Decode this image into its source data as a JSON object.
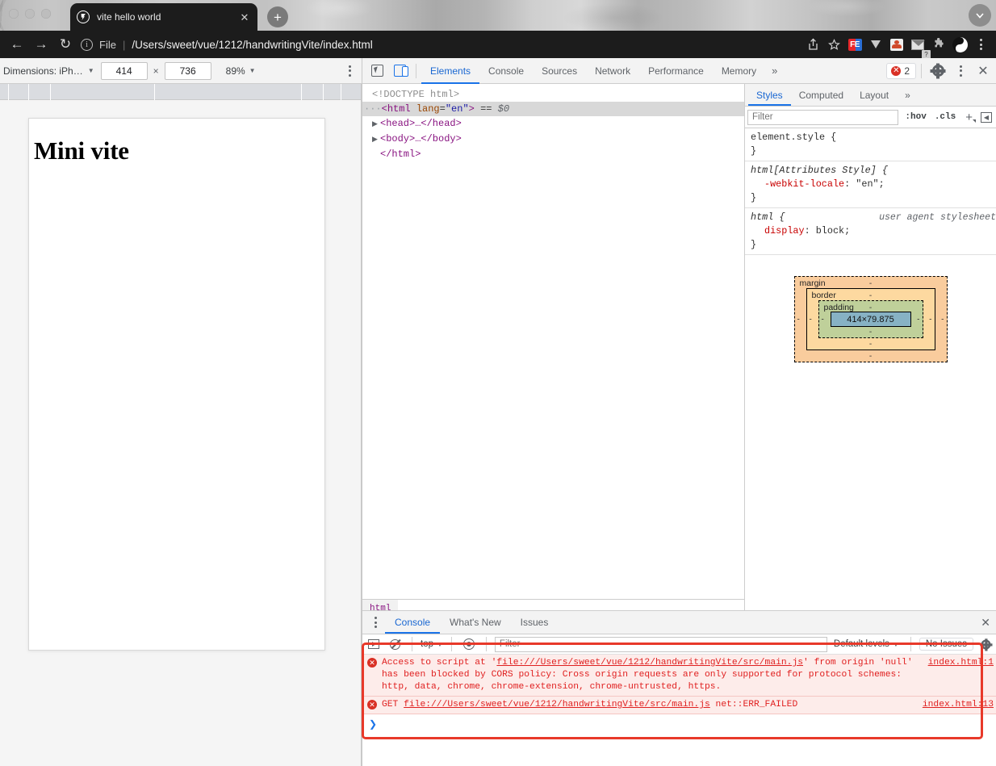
{
  "browser": {
    "tab": {
      "title": "vite hello world",
      "favicon": "globe-icon",
      "close": "✕"
    },
    "new_tab": "+",
    "tabstrip_chevron": "∨",
    "nav": {
      "back": "←",
      "forward": "→",
      "reload": "↻"
    },
    "omnibox": {
      "info_icon": "i",
      "scheme_label": "File",
      "separator": "|",
      "url": "/Users/sweet/vue/1212/handwritingVite/index.html"
    },
    "toolbar_icons": [
      {
        "name": "share-icon",
        "glyph": "⤴"
      },
      {
        "name": "bookmark-star-icon",
        "glyph": "☆"
      },
      {
        "name": "extension-fe-icon",
        "glyph": "FE"
      },
      {
        "name": "extension-v-icon",
        "glyph": "▼"
      },
      {
        "name": "extension-people-icon",
        "glyph": ""
      },
      {
        "name": "extension-mail-icon",
        "glyph": ""
      },
      {
        "name": "extension-puzzle-icon",
        "glyph": "❖"
      },
      {
        "name": "profile-avatar-icon",
        "glyph": ""
      },
      {
        "name": "chrome-menu-icon",
        "glyph": ""
      }
    ]
  },
  "device_toolbar": {
    "dimensions_label": "Dimensions: iPh…",
    "width": "414",
    "times": "×",
    "height": "736",
    "zoom": "89%",
    "caret": "▼",
    "more_label": "more-options"
  },
  "page_preview": {
    "heading": "Mini vite"
  },
  "devtools": {
    "inspect_icon": "inspect-element-icon",
    "device_icon": "toggle-device-toolbar-icon",
    "tabs": [
      {
        "label": "Elements",
        "active": true
      },
      {
        "label": "Console",
        "active": false
      },
      {
        "label": "Sources",
        "active": false
      },
      {
        "label": "Network",
        "active": false
      },
      {
        "label": "Performance",
        "active": false
      },
      {
        "label": "Memory",
        "active": false
      }
    ],
    "more_tabs": "»",
    "error_count": "2",
    "error_dot": "✕",
    "settings_icon": "gear-icon",
    "kebab_icon": "more-options-icon",
    "close_icon": "✕"
  },
  "elements": {
    "dom": [
      {
        "indent": 0,
        "prefix": "",
        "triangle": "",
        "content": "<!DOCTYPE html>",
        "selected": false,
        "kind": "doctype"
      },
      {
        "indent": 0,
        "prefix": "···",
        "triangle": "",
        "content": "<html lang=\"en\"> == $0",
        "selected": true,
        "kind": "open-html"
      },
      {
        "indent": 1,
        "prefix": "",
        "triangle": "▶",
        "content": "<head>…</head>",
        "selected": false,
        "kind": "collapsed"
      },
      {
        "indent": 1,
        "prefix": "",
        "triangle": "▶",
        "content": "<body>…</body>",
        "selected": false,
        "kind": "collapsed"
      },
      {
        "indent": 0,
        "prefix": "",
        "triangle": "",
        "content": "</html>",
        "selected": false,
        "kind": "close"
      }
    ],
    "html_tag_name": "html",
    "html_attr_name": "lang",
    "html_attr_value": "\"en\"",
    "dollar_zero": "$0",
    "equals": "==",
    "breadcrumb": [
      "html"
    ]
  },
  "styles": {
    "tabs": [
      {
        "label": "Styles",
        "active": true
      },
      {
        "label": "Computed",
        "active": false
      },
      {
        "label": "Layout",
        "active": false
      }
    ],
    "more_tabs": "»",
    "filter_placeholder": "Filter",
    "hov_label": ":hov",
    "cls_label": ".cls",
    "plus_label": "+",
    "collapse_label": "◀",
    "rules": [
      {
        "selector": "element.style {",
        "close": "}",
        "italic": false,
        "source": "",
        "declarations": []
      },
      {
        "selector": "html[Attributes Style] {",
        "close": "}",
        "italic": true,
        "source": "",
        "declarations": [
          {
            "name": "-webkit-locale",
            "value": ": \"en\";"
          }
        ]
      },
      {
        "selector": "html {",
        "close": "}",
        "italic": true,
        "source": "user agent stylesheet",
        "declarations": [
          {
            "name": "display",
            "value": ": block;"
          }
        ]
      }
    ],
    "box_model": {
      "margin_label": "margin",
      "border_label": "border",
      "padding_label": "padding",
      "content_size": "414×79.875",
      "dash": "-"
    }
  },
  "drawer": {
    "kebab": "more-options-icon",
    "tabs": [
      {
        "label": "Console",
        "active": true
      },
      {
        "label": "What's New",
        "active": false
      },
      {
        "label": "Issues",
        "active": false
      }
    ],
    "close": "✕",
    "toolbar": {
      "sidebar_icon": "console-sidebar-icon",
      "clear_icon": "clear-console-icon",
      "context": "top",
      "context_caret": "▼",
      "eye_icon": "live-expression-icon",
      "filter_placeholder": "Filter",
      "levels_label": "Default levels",
      "levels_caret": "▼",
      "issues_label": "No Issues",
      "settings_icon": "gear-icon"
    },
    "messages": [
      {
        "icon": "✕",
        "parts": [
          {
            "t": "Access to script at '",
            "link": false
          },
          {
            "t": "file:///Users/sweet/vue/1212/handwritingVite/src/main.js",
            "link": true
          },
          {
            "t": "' from origin 'null' has been blocked by CORS policy: Cross origin requests are only supported for protocol schemes: http, data, chrome, chrome-extension, chrome-untrusted, https.",
            "link": false
          }
        ],
        "source": "index.html:1"
      },
      {
        "icon": "✕",
        "parts": [
          {
            "t": "GET ",
            "link": false
          },
          {
            "t": "file:///Users/sweet/vue/1212/handwritingVite/src/main.js",
            "link": true
          },
          {
            "t": " net::ERR_FAILED",
            "link": false
          }
        ],
        "source": "index.html:13"
      }
    ],
    "prompt": "❯"
  },
  "colors": {
    "accent_blue": "#1a73e8",
    "error_red": "#d93025",
    "annotation_red": "#e8392a",
    "box_margin": "#f9cc9d",
    "box_border": "#fdd9a0",
    "box_padding": "#bfd09a",
    "box_content": "#87b2c4"
  }
}
